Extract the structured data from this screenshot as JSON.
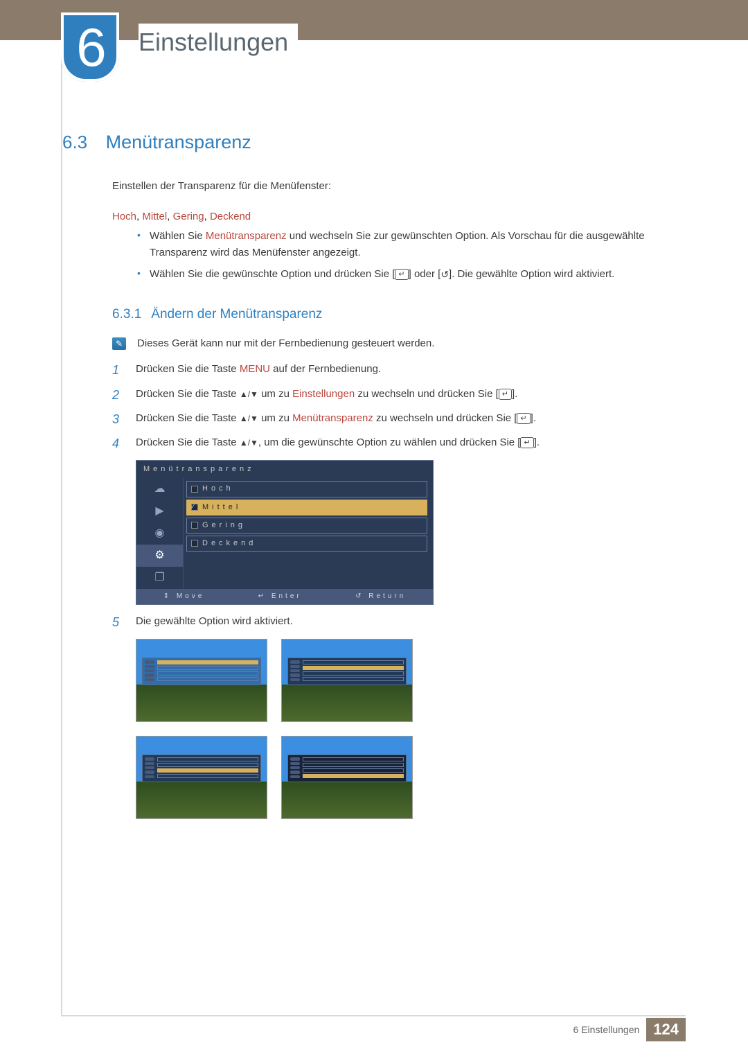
{
  "chapter": {
    "number": "6",
    "title": "Einstellungen"
  },
  "section": {
    "number": "6.3",
    "title": "Menütransparenz"
  },
  "intro": "Einstellen der Transparenz für die Menüfenster:",
  "options": {
    "o1": "Hoch",
    "o2": "Mittel",
    "o3": "Gering",
    "o4": "Deckend",
    "sep": ", "
  },
  "bullet1": {
    "pre": "Wählen Sie ",
    "em": "Menütransparenz",
    "post": " und wechseln Sie zur gewünschten Option. Als Vorschau für die ausgewählte Transparenz wird das Menüfenster angezeigt."
  },
  "bullet2": {
    "pre": "Wählen Sie die gewünschte Option und drücken Sie [",
    "mid": "] oder [",
    "post": "]. Die gewählte Option wird aktiviert."
  },
  "subsection": {
    "number": "6.3.1",
    "title": "Ändern der Menütransparenz"
  },
  "note": "Dieses Gerät kann nur mit der Fernbedienung gesteuert werden.",
  "steps": {
    "s1": {
      "pre": "Drücken Sie die Taste ",
      "em": "MENU",
      "post": " auf der Fernbedienung."
    },
    "s2": {
      "pre": "Drücken Sie die Taste ",
      "arrows": "▲/▼",
      "mid": " um zu ",
      "em": "Einstellungen",
      "post": " zu wechseln und drücken Sie [",
      "end": "]."
    },
    "s3": {
      "pre": "Drücken Sie die Taste ",
      "arrows": "▲/▼",
      "mid": " um zu ",
      "em": "Menütransparenz",
      "post": " zu wechseln und drücken Sie [",
      "end": "]."
    },
    "s4": {
      "pre": "Drücken Sie die Taste ",
      "arrows": "▲/▼",
      "mid": ", um die gewünschte Option zu wählen und drücken Sie [",
      "end": "]."
    },
    "s5": "Die gewählte Option wird aktiviert."
  },
  "osd": {
    "title": "Menütransparenz",
    "items": {
      "i1": "Hoch",
      "i2": "Mittel",
      "i3": "Gering",
      "i4": "Deckend"
    },
    "selected": "Mittel",
    "footer": {
      "move": "Move",
      "enter": "Enter",
      "return": "Return"
    }
  },
  "icons": {
    "enter": "↵",
    "return": "↺",
    "note": "✎",
    "move_glyph": "⇕"
  },
  "footer": {
    "label": "6 Einstellungen",
    "page": "124"
  }
}
